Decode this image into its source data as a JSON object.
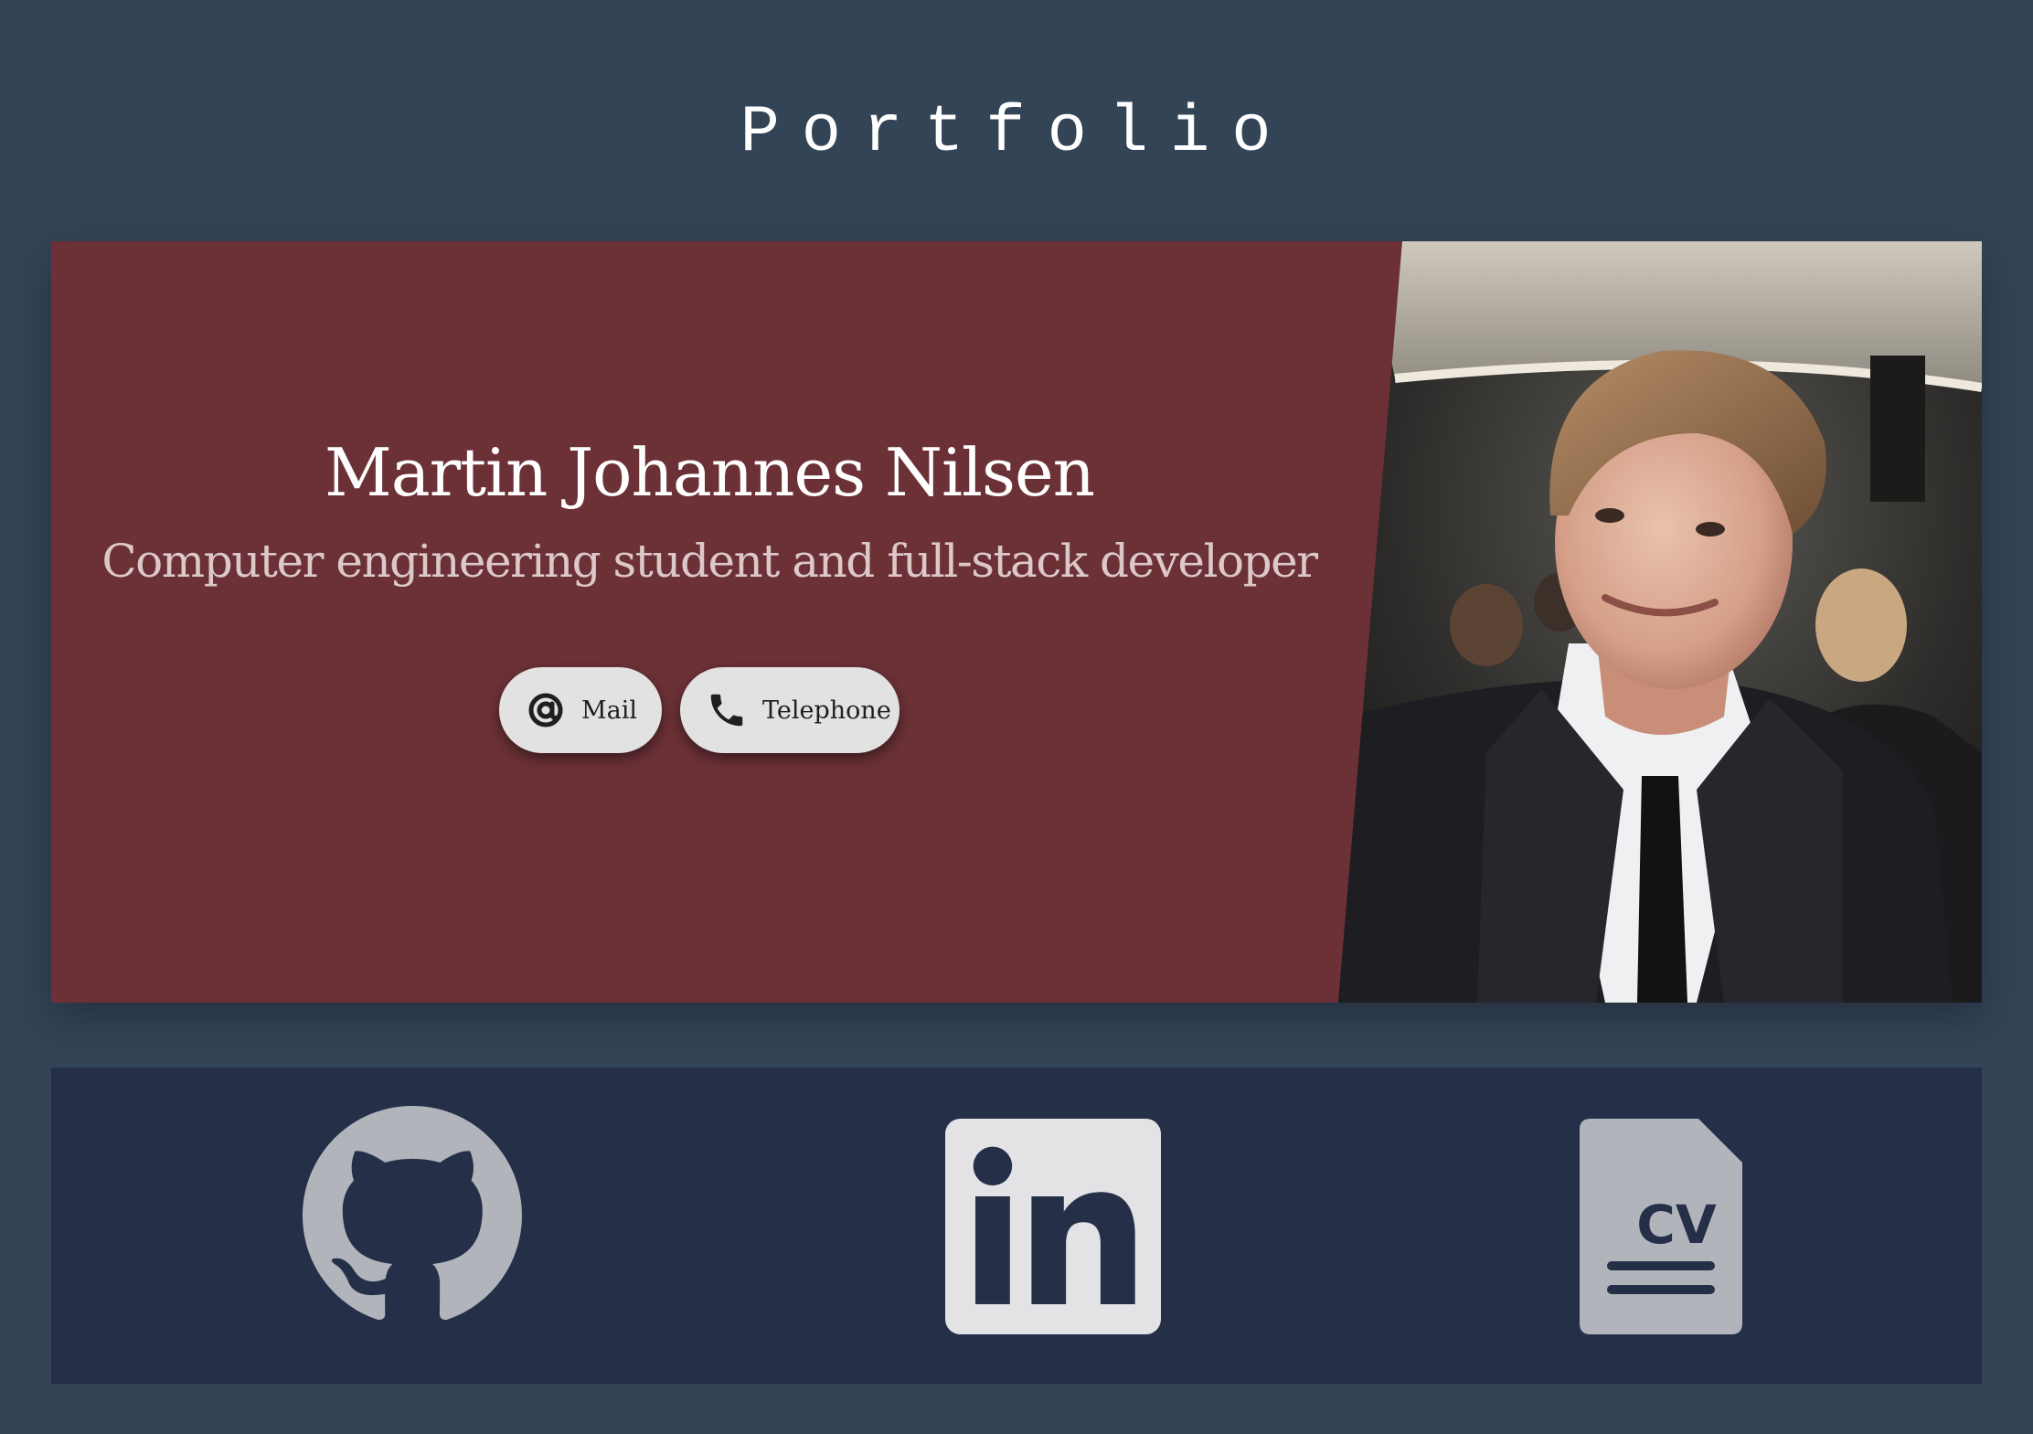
{
  "header": {
    "title": "Portfolio"
  },
  "hero": {
    "name": "Martin Johannes Nilsen",
    "subtitle": "Computer engineering student and full-stack developer",
    "photo_alt": "Photo of Martin Johannes Nilsen",
    "contact": {
      "mail_label": "Mail",
      "mail_icon": "at-sign-icon",
      "telephone_label": "Telephone",
      "telephone_icon": "phone-icon"
    }
  },
  "links": {
    "items": [
      {
        "label": "GitHub",
        "icon": "github-icon"
      },
      {
        "label": "LinkedIn",
        "icon": "linkedin-icon"
      },
      {
        "label": "CV",
        "icon": "cv-document-icon",
        "text": "CV"
      }
    ]
  },
  "colors": {
    "page_background": "#344457",
    "hero_panel": "#6b3136",
    "links_bar": "#252f48",
    "button_background": "#e3e2e3",
    "icon_gray": "#b1b4ba"
  }
}
